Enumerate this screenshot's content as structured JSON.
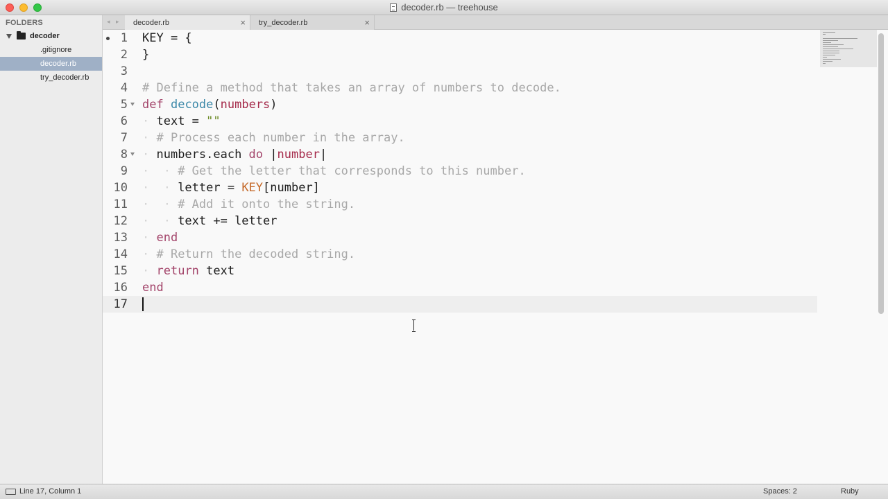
{
  "window": {
    "title": "decoder.rb — treehouse",
    "doc_icon": "document-icon"
  },
  "sidebar": {
    "header": "FOLDERS",
    "folder": {
      "name": "decoder",
      "icon": "folder-icon",
      "expanded": true
    },
    "files": [
      {
        "name": ".gitignore",
        "selected": false
      },
      {
        "name": "decoder.rb",
        "selected": true
      },
      {
        "name": "try_decoder.rb",
        "selected": false
      }
    ]
  },
  "tabs": {
    "nav_arrows": "◂ ▸",
    "close_glyph": "×",
    "items": [
      {
        "label": "decoder.rb",
        "active": true
      },
      {
        "label": "try_decoder.rb",
        "active": false
      }
    ]
  },
  "editor": {
    "current_line": 17,
    "modified": true,
    "lines": [
      {
        "n": "1",
        "tokens": [
          [
            "p",
            "KEY = {"
          ]
        ]
      },
      {
        "n": "2",
        "tokens": [
          [
            "p",
            "}"
          ]
        ]
      },
      {
        "n": "3",
        "tokens": []
      },
      {
        "n": "4",
        "tokens": [
          [
            "c",
            "# Define a method that takes an array of numbers to decode."
          ]
        ]
      },
      {
        "n": "5",
        "fold": true,
        "tokens": [
          [
            "k",
            "def"
          ],
          [
            "p",
            " "
          ],
          [
            "f",
            "decode"
          ],
          [
            "p",
            "("
          ],
          [
            "a",
            "numbers"
          ],
          [
            "p",
            ")"
          ]
        ]
      },
      {
        "n": "6",
        "tokens": [
          [
            "w",
            "·"
          ],
          [
            "p",
            " text = "
          ],
          [
            "s",
            "\"\""
          ]
        ]
      },
      {
        "n": "7",
        "tokens": [
          [
            "w",
            "·"
          ],
          [
            "c",
            " # Process each number in the array."
          ]
        ]
      },
      {
        "n": "8",
        "fold": true,
        "tokens": [
          [
            "w",
            "·"
          ],
          [
            "p",
            " numbers.each "
          ],
          [
            "k",
            "do"
          ],
          [
            "p",
            " |"
          ],
          [
            "a",
            "number"
          ],
          [
            "p",
            "|"
          ]
        ]
      },
      {
        "n": "9",
        "tokens": [
          [
            "w",
            "·  ·"
          ],
          [
            "c",
            " # Get the letter that corresponds to this number."
          ]
        ]
      },
      {
        "n": "10",
        "tokens": [
          [
            "w",
            "·  ·"
          ],
          [
            "p",
            " letter = "
          ],
          [
            "o",
            "KEY"
          ],
          [
            "p",
            "[number]"
          ]
        ]
      },
      {
        "n": "11",
        "tokens": [
          [
            "w",
            "·  ·"
          ],
          [
            "c",
            " # Add it onto the string."
          ]
        ]
      },
      {
        "n": "12",
        "tokens": [
          [
            "w",
            "·  ·"
          ],
          [
            "p",
            " text += letter"
          ]
        ]
      },
      {
        "n": "13",
        "tokens": [
          [
            "w",
            "·"
          ],
          [
            "p",
            " "
          ],
          [
            "k",
            "end"
          ]
        ]
      },
      {
        "n": "14",
        "tokens": [
          [
            "w",
            "·"
          ],
          [
            "c",
            " # Return the decoded string."
          ]
        ]
      },
      {
        "n": "15",
        "tokens": [
          [
            "w",
            "·"
          ],
          [
            "p",
            " "
          ],
          [
            "k",
            "return"
          ],
          [
            "p",
            " text"
          ]
        ]
      },
      {
        "n": "16",
        "tokens": [
          [
            "k",
            "end"
          ]
        ]
      },
      {
        "n": "17",
        "tokens": []
      }
    ]
  },
  "status": {
    "icon": "panel-toggle-icon",
    "position": "Line 17, Column 1",
    "indentation": "Spaces: 2",
    "syntax": "Ruby"
  }
}
